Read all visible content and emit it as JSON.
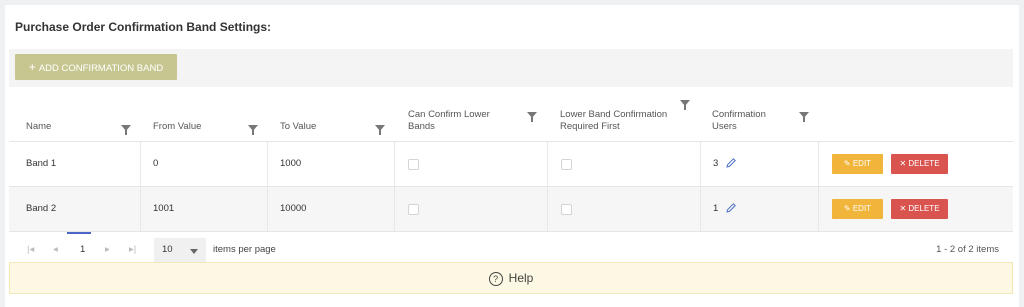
{
  "page": {
    "title": "Purchase Order Confirmation Band Settings:"
  },
  "toolbar": {
    "add_label": "ADD CONFIRMATION BAND"
  },
  "grid": {
    "columns": [
      {
        "label": "Name"
      },
      {
        "label": "From Value"
      },
      {
        "label": "To Value"
      },
      {
        "label": "Can Confirm Lower Bands"
      },
      {
        "label": "Lower Band Confirmation Required First"
      },
      {
        "label": "Confirmation Users"
      }
    ],
    "rows": [
      {
        "name": "Band 1",
        "from": "0",
        "to": "1000",
        "can_confirm_lower": false,
        "lower_required_first": false,
        "users": "3"
      },
      {
        "name": "Band 2",
        "from": "1001",
        "to": "10000",
        "can_confirm_lower": false,
        "lower_required_first": false,
        "users": "1"
      }
    ],
    "edit_label": "EDIT",
    "delete_label": "DELETE"
  },
  "pager": {
    "current_page": "1",
    "page_size": "10",
    "items_per_page_label": "items per page",
    "summary": "1 - 2 of 2 items"
  },
  "help": {
    "label": "Help"
  },
  "colors": {
    "add_button": "#c8c690",
    "edit_button": "#f0b53a",
    "delete_button": "#d9534f",
    "help_bar": "#fcf8e3",
    "active_page": "#4a67c8"
  }
}
